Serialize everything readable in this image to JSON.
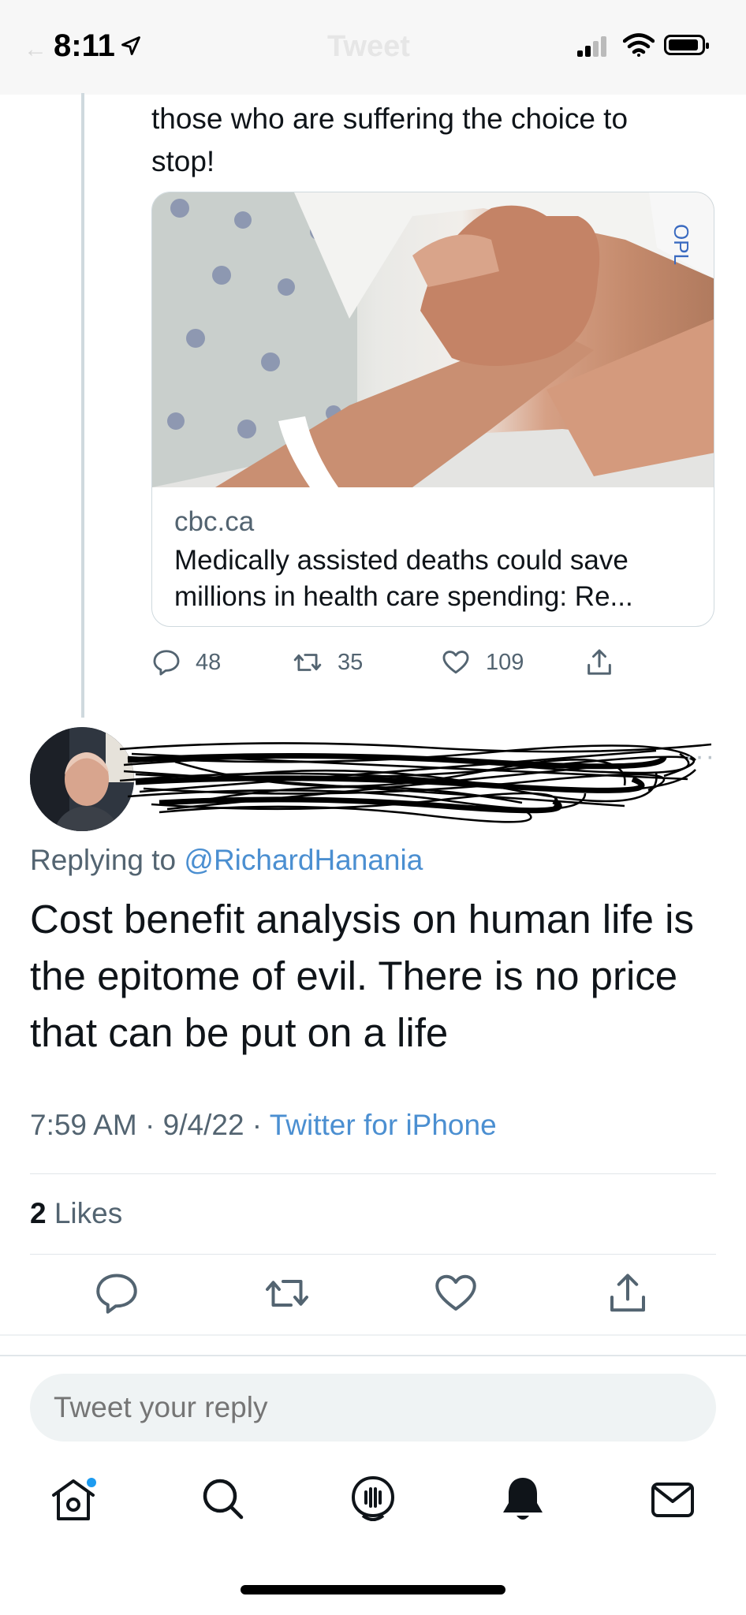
{
  "status_bar": {
    "time": "8:11",
    "nav_title": "Tweet"
  },
  "parent_tweet": {
    "text": "those who are suffering the choice to stop!",
    "link_card": {
      "domain": "cbc.ca",
      "title": "Medically assisted deaths could save millions in health care spending: Re..."
    },
    "counts": {
      "replies": "48",
      "retweets": "35",
      "likes": "109"
    }
  },
  "reply_tweet": {
    "replying_prefix": "Replying to ",
    "replying_handle": "@RichardHanania",
    "text": "Cost benefit analysis on human life is the epitome of evil. There is no price that can be put on a life",
    "time": "7:59 AM",
    "separator": " · ",
    "date": "9/4/22",
    "source": "Twitter for iPhone",
    "likes_count": "2",
    "likes_label": " Likes"
  },
  "composer": {
    "placeholder": "Tweet your reply"
  },
  "colors": {
    "link": "#4b8fd1",
    "secondary_text": "#536471",
    "notification_dot": "#1d9bf0"
  },
  "icons": {
    "parent_actions": [
      "reply-icon",
      "retweet-icon",
      "like-icon",
      "share-icon"
    ],
    "tabbar": [
      "home-icon",
      "search-icon",
      "spaces-icon",
      "notifications-icon",
      "messages-icon"
    ]
  }
}
